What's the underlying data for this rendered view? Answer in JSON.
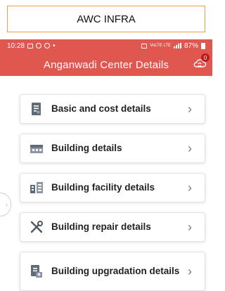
{
  "page": {
    "title": "AWC INFRA"
  },
  "status_bar": {
    "time": "10:28",
    "dot": "•",
    "network_text": "VoLTE LTE",
    "battery": "87%"
  },
  "app_bar": {
    "title": "Anganwadi Center Details",
    "sync_badge_count": "0",
    "accent": "#e0574f"
  },
  "menu": {
    "items": [
      {
        "label": "Basic and cost details",
        "icon": "document-icon"
      },
      {
        "label": "Building details",
        "icon": "building-icon"
      },
      {
        "label": "Building facility details",
        "icon": "facility-icon"
      },
      {
        "label": "Building repair details",
        "icon": "repair-tools-icon"
      },
      {
        "label": "Building upgradation details",
        "icon": "upgrade-document-icon"
      }
    ],
    "chevron": "›"
  }
}
